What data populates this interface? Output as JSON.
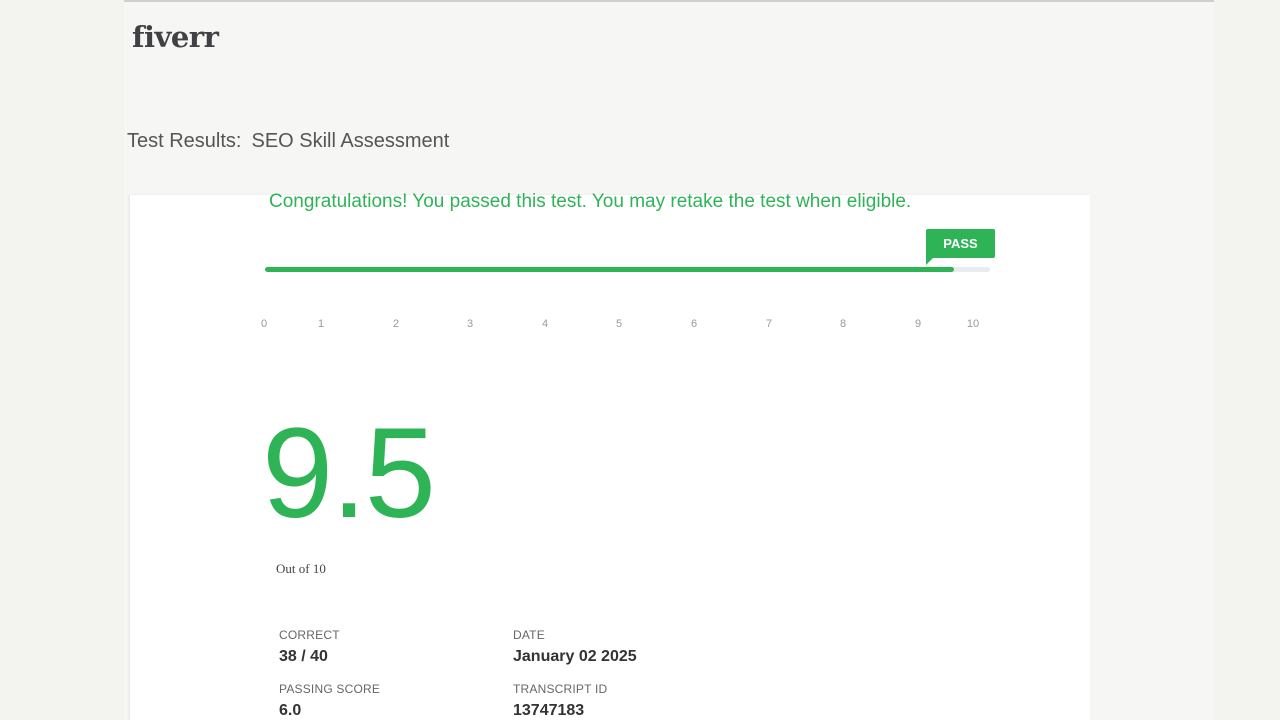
{
  "brand": {
    "logo_text": "fiverr"
  },
  "heading": {
    "prefix": "Test Results:",
    "test_name": "SEO Skill Assessment"
  },
  "result": {
    "message": "Congratulations! You passed this test. You may retake the test when eligible.",
    "badge": "PASS",
    "score": "9.5",
    "score_max": 10,
    "out_of_label": "Out of 10",
    "progress_fraction": 0.95,
    "scale_ticks": [
      "0",
      "1",
      "2",
      "3",
      "4",
      "5",
      "6",
      "7",
      "8",
      "9",
      "10"
    ]
  },
  "stats": {
    "correct_label": "CORRECT",
    "correct_value": "38 / 40",
    "date_label": "DATE",
    "date_value": "January 02 2025",
    "passing_label": "PASSING SCORE",
    "passing_value": "6.0",
    "transcript_label": "TRANSCRIPT ID",
    "transcript_value": "13747183"
  },
  "colors": {
    "accent": "#2fb357",
    "text": "#333333",
    "muted": "#9a9a9a"
  }
}
